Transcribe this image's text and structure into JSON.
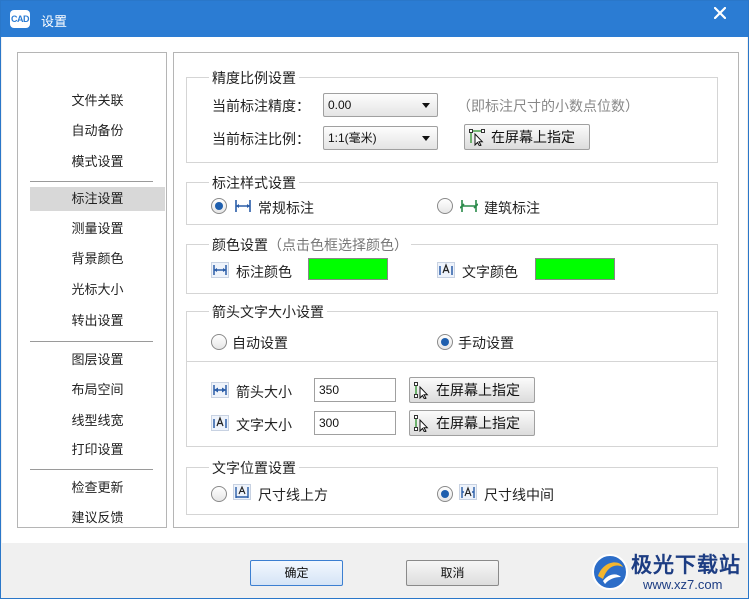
{
  "window": {
    "title": "设置",
    "logo_text": "CAD"
  },
  "nav": {
    "items": [
      {
        "label": "文件关联"
      },
      {
        "label": "自动备份"
      },
      {
        "label": "模式设置"
      },
      {
        "label": "标注设置",
        "selected": true
      },
      {
        "label": "测量设置"
      },
      {
        "label": "背景颜色"
      },
      {
        "label": "光标大小"
      },
      {
        "label": "转出设置"
      },
      {
        "label": "图层设置"
      },
      {
        "label": "布局空间"
      },
      {
        "label": "线型线宽"
      },
      {
        "label": "打印设置"
      },
      {
        "label": "检查更新"
      },
      {
        "label": "建议反馈"
      }
    ]
  },
  "precision": {
    "title": "精度比例设置",
    "precision_label": "当前标注精度：",
    "precision_value": "0.00",
    "precision_hint": "（即标注尺寸的小数点位数）",
    "scale_label": "当前标注比例：",
    "scale_value": "1:1(毫米)",
    "pick_label": "在屏幕上指定"
  },
  "style": {
    "title": "标注样式设置",
    "normal_label": "常规标注",
    "normal_selected": true,
    "arch_label": "建筑标注",
    "arch_selected": false
  },
  "color": {
    "title": "颜色设置",
    "title_hint": "（点击色框选择颜色）",
    "dim_color_label": "标注颜色",
    "dim_color": "#00ff00",
    "text_color_label": "文字颜色",
    "text_color": "#00ff00"
  },
  "size": {
    "title": "箭头文字大小设置",
    "auto_label": "自动设置",
    "auto_selected": false,
    "manual_label": "手动设置",
    "manual_selected": true,
    "arrow_label": "箭头大小",
    "arrow_value": "350",
    "text_label": "文字大小",
    "text_value": "300",
    "pick_label": "在屏幕上指定"
  },
  "position": {
    "title": "文字位置设置",
    "above_label": "尺寸线上方",
    "above_selected": false,
    "middle_label": "尺寸线中间",
    "middle_selected": true
  },
  "footer": {
    "ok_label": "确定",
    "cancel_label": "取消"
  },
  "watermark": {
    "brand": "极光下载站",
    "url": "www.xz7.com"
  },
  "colors": {
    "titlebar": "#2b7cd3",
    "accent": "#1f5fae"
  }
}
